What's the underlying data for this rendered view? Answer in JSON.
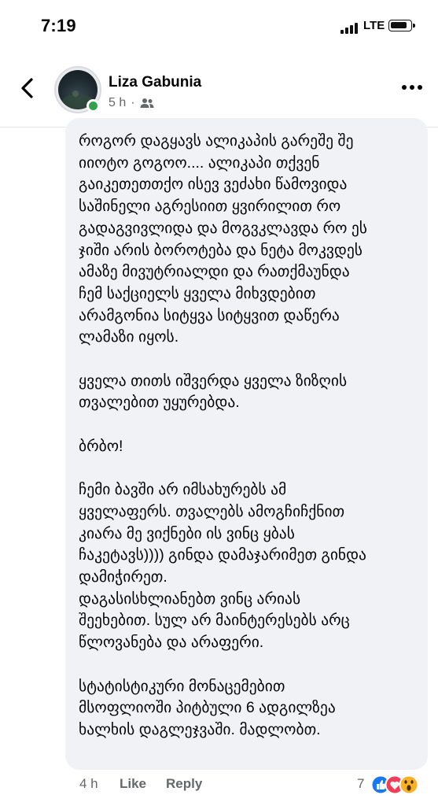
{
  "status_bar": {
    "time": "7:19",
    "network": "LTE"
  },
  "header": {
    "author": "Liza Gabunia",
    "posted": "5 h",
    "separator": "·",
    "audience_icon": "friends-icon"
  },
  "comment": {
    "text": "როგორ დაგყავს ალიკაპის გარეშე შე\nიიოტო გოგოო.... ალიკაპი თქვენ\nგაიკეთეთთქო ისევ ვეძახი წამოვიდა\nსაშინელი აგრესიით ყვირილით რო\nგადაგვივლიდა და მოგვკლავდა რო ეს\nჯიში არის ბოროტება და ნეტა მოკვდეს\nამაზე მივუტრიალდი და რათქმაუნდა\nჩემ საქციელს ყველა მიხვდებით\nარამგონია სიტყვა სიტყვით დაწერა\nლამაზი იყოს.\n\nყველა თითს იშვერდა ყველა ზიზღის\nთვალებით უყურებდა.\n\nბრბო!\n\nჩემი ბავში არ იმსახურებს ამ\nყველაფერს. თვალებს ამოგჩიჩქნით\nკიარა მე ვიქნები ის ვინც ყბას\nჩაკეტავს)))) გინდა დამაჯარიმეთ გინდა\nდამიჭირეთ.\nდაგასისხლიანებთ ვინც არიას\nშეეხებით. სულ არ მაინტერესებს არც\nწლოვანება და არაფერი.\n\nსტატისტიკური მონაცემებით\nმსოფლიოში პიტბული 6 ადგილზეა\nხალხის დაგლეჯვაში. მადლობთ."
  },
  "footer": {
    "time": "4 h",
    "like_label": "Like",
    "reply_label": "Reply",
    "reaction_count": "7",
    "reaction_icons": [
      "like-icon",
      "love-icon",
      "wow-icon"
    ]
  },
  "colors": {
    "accent_blue": "#1877f2",
    "love_red": "#f33e58",
    "wow_yellow": "#f7b125",
    "online_green": "#31a24c",
    "bubble_bg": "#f0f2f5",
    "secondary_text": "#65676b"
  }
}
